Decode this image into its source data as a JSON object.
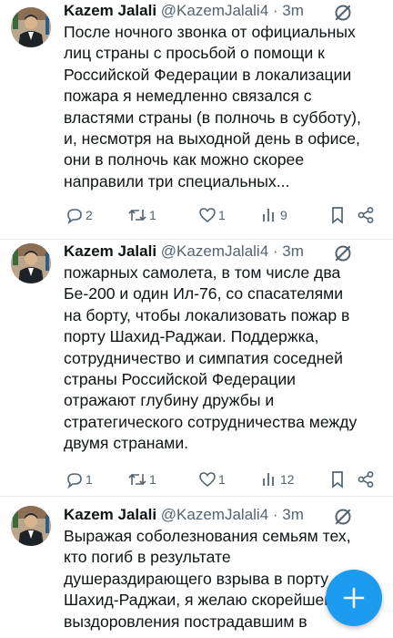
{
  "accent": "#1d9bf0",
  "tweets": [
    {
      "name": "Kazem Jalali",
      "handle": "@KazemJalali4",
      "time": "· 3m",
      "lines": [
        "После ночного звонка от официальных",
        "лиц страны с просьбой о помощи к",
        "Российской Федерации в локализации",
        "пожара я немедленно связался с",
        "властями страны (в полночь в субботу),",
        "и, несмотря на выходной день в офисе,",
        "они в полночь как можно скорее",
        "направили три специальных..."
      ],
      "replies": "2",
      "reposts": "1",
      "likes": "1",
      "views": "9"
    },
    {
      "name": "Kazem Jalali",
      "handle": "@KazemJalali4",
      "time": "· 3m",
      "lines": [
        "пожарных самолета, в том числе два",
        "Бе-200 и один Ил-76, со спасателями",
        "на борту, чтобы локализовать пожар в",
        "порту Шахид-Раджаи. Поддержка,",
        "сотрудничество и симпатия соседней",
        "страны Российской Федерации",
        "отражают глубину дружбы и",
        "стратегического сотрудничества между",
        "двумя странами."
      ],
      "replies": "1",
      "reposts": "1",
      "likes": "1",
      "views": "12"
    },
    {
      "name": "Kazem Jalali",
      "handle": "@KazemJalali4",
      "time": "· 3m",
      "lines": [
        "Выражая соболезнования семьям тех,",
        "кто погиб в результате",
        "душераздирающего взрыва в порту",
        "Шахид-Раджаи, я желаю скорейшего",
        "выздоровления пострадавшим в"
      ]
    }
  ],
  "fab_icon": "plus-icon"
}
